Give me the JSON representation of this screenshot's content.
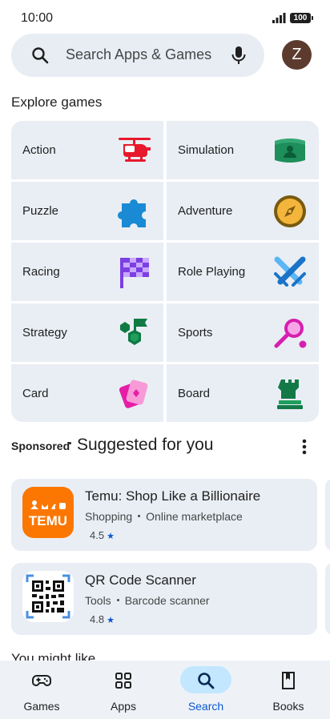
{
  "status_bar": {
    "time": "10:00",
    "battery": "100"
  },
  "search": {
    "placeholder": "Search Apps & Games"
  },
  "account": {
    "initial": "Z",
    "color": "#5c3b2e"
  },
  "explore": {
    "title": "Explore games",
    "categories": [
      {
        "label": "Action",
        "icon": "helicopter-icon"
      },
      {
        "label": "Simulation",
        "icon": "hologram-icon"
      },
      {
        "label": "Puzzle",
        "icon": "puzzle-piece-icon"
      },
      {
        "label": "Adventure",
        "icon": "compass-icon"
      },
      {
        "label": "Racing",
        "icon": "checkered-flag-icon"
      },
      {
        "label": "Role Playing",
        "icon": "crossed-swords-icon"
      },
      {
        "label": "Strategy",
        "icon": "strategy-flag-icon"
      },
      {
        "label": "Sports",
        "icon": "tennis-racket-icon"
      },
      {
        "label": "Card",
        "icon": "playing-card-icon"
      },
      {
        "label": "Board",
        "icon": "chess-rook-icon"
      }
    ]
  },
  "suggested": {
    "sponsored_label": "Sponsored",
    "title": "Suggested for you",
    "apps": [
      {
        "name": "Temu: Shop Like a Billionaire",
        "category": "Shopping",
        "subcategory": "Online marketplace",
        "rating": "4.5",
        "icon": "temu-logo",
        "icon_text": "TEMU",
        "icon_color": "#fb7701"
      },
      {
        "name": "QR Code Scanner",
        "category": "Tools",
        "subcategory": "Barcode scanner",
        "rating": "4.8",
        "icon": "qr-code-icon"
      }
    ]
  },
  "you_might_like": {
    "title": "You might like"
  },
  "bottom_nav": {
    "active": "Search",
    "active_color": "#0b57d0",
    "items": [
      {
        "label": "Games",
        "icon": "gamepad-icon"
      },
      {
        "label": "Apps",
        "icon": "apps-grid-icon"
      },
      {
        "label": "Search",
        "icon": "search-icon"
      },
      {
        "label": "Books",
        "icon": "book-icon"
      }
    ]
  }
}
